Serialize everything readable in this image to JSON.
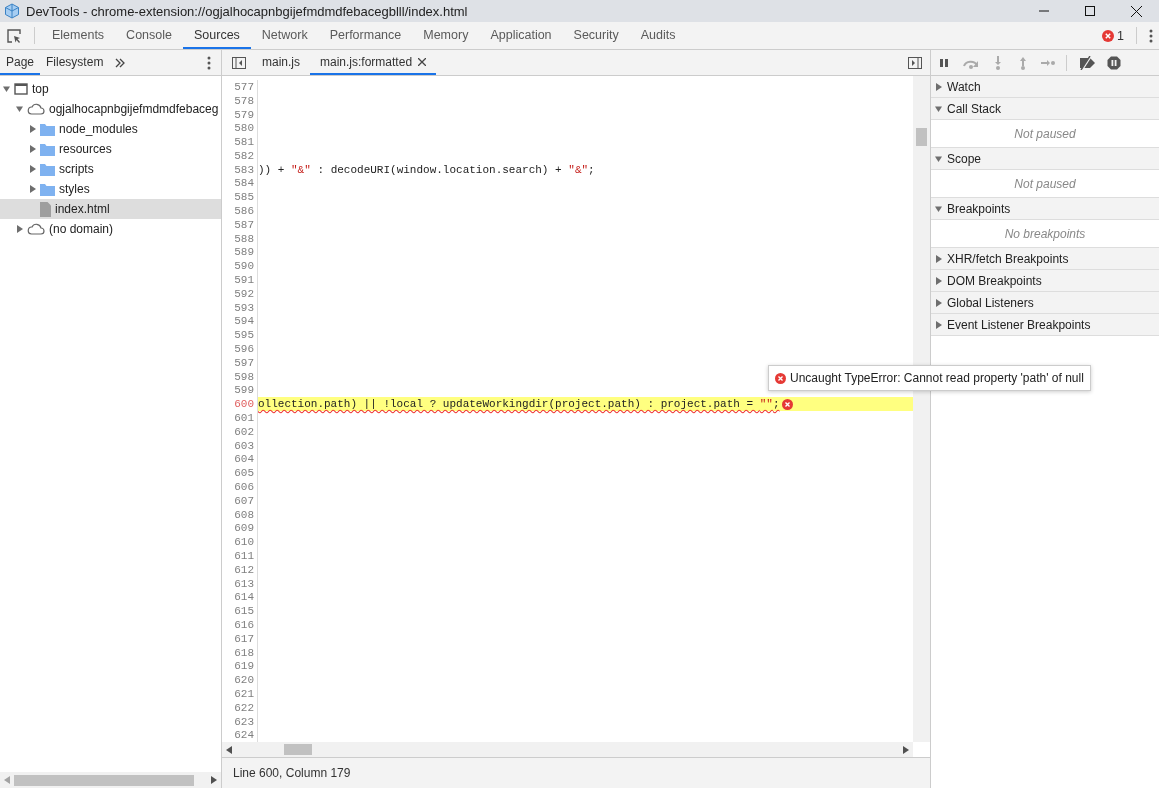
{
  "window": {
    "title": "DevTools - chrome-extension://ogjalhocapnbgijefmdmdfebacegblll/index.html"
  },
  "main_tabs": [
    {
      "label": "Elements",
      "selected": false
    },
    {
      "label": "Console",
      "selected": false
    },
    {
      "label": "Sources",
      "selected": true
    },
    {
      "label": "Network",
      "selected": false
    },
    {
      "label": "Performance",
      "selected": false
    },
    {
      "label": "Memory",
      "selected": false
    },
    {
      "label": "Application",
      "selected": false
    },
    {
      "label": "Security",
      "selected": false
    },
    {
      "label": "Audits",
      "selected": false
    }
  ],
  "error_count": "1",
  "navigator": {
    "tabs": [
      {
        "label": "Page",
        "selected": true
      },
      {
        "label": "Filesystem",
        "selected": false
      }
    ],
    "tree": [
      {
        "label": "top",
        "kind": "frame",
        "expanded": true,
        "selected": false,
        "children": [
          {
            "label": "ogjalhocapnbgijefmdmdfebaceg",
            "kind": "domain",
            "expanded": true,
            "selected": false,
            "children": [
              {
                "label": "node_modules",
                "kind": "folder",
                "expanded": false,
                "selected": false
              },
              {
                "label": "resources",
                "kind": "folder",
                "expanded": false,
                "selected": false
              },
              {
                "label": "scripts",
                "kind": "folder",
                "expanded": false,
                "selected": false
              },
              {
                "label": "styles",
                "kind": "folder",
                "expanded": false,
                "selected": false
              },
              {
                "label": "index.html",
                "kind": "file",
                "selected": true
              }
            ]
          },
          {
            "label": "(no domain)",
            "kind": "domain",
            "expanded": false,
            "selected": false
          }
        ]
      }
    ]
  },
  "editor": {
    "tabs": [
      {
        "label": "main.js",
        "selected": false
      },
      {
        "label": "main.js:formatted",
        "selected": true
      }
    ],
    "lines": [
      {
        "number": "577",
        "error": false
      },
      {
        "number": "578",
        "error": false
      },
      {
        "number": "579",
        "error": false
      },
      {
        "number": "580",
        "error": false
      },
      {
        "number": "581",
        "error": false
      },
      {
        "number": "582",
        "error": false
      },
      {
        "number": "583",
        "error": false,
        "tokens": [
          {
            "text": ")) + ",
            "kind": "plain"
          },
          {
            "text": "\"&\"",
            "kind": "string"
          },
          {
            "text": " : decodeURI(window.location.search) + ",
            "kind": "plain"
          },
          {
            "text": "\"&\"",
            "kind": "string"
          },
          {
            "text": ";",
            "kind": "plain"
          }
        ]
      },
      {
        "number": "584",
        "error": false
      },
      {
        "number": "585",
        "error": false
      },
      {
        "number": "586",
        "error": false
      },
      {
        "number": "587",
        "error": false
      },
      {
        "number": "588",
        "error": false
      },
      {
        "number": "589",
        "error": false
      },
      {
        "number": "590",
        "error": false
      },
      {
        "number": "591",
        "error": false
      },
      {
        "number": "592",
        "error": false
      },
      {
        "number": "593",
        "error": false
      },
      {
        "number": "594",
        "error": false
      },
      {
        "number": "595",
        "error": false
      },
      {
        "number": "596",
        "error": false
      },
      {
        "number": "597",
        "error": false
      },
      {
        "number": "598",
        "error": false
      },
      {
        "number": "599",
        "error": false
      },
      {
        "number": "600",
        "error": true,
        "message": "Uncaught TypeError: Cannot read property 'path' of null",
        "tokens": [
          {
            "text": "ollection.path) || !local ? updateWorkingdir(project.path) : project.path = ",
            "kind": "plain"
          },
          {
            "text": "\"\"",
            "kind": "string"
          },
          {
            "text": ";",
            "kind": "plain"
          }
        ]
      },
      {
        "number": "601",
        "error": false
      },
      {
        "number": "602",
        "error": false
      },
      {
        "number": "603",
        "error": false
      },
      {
        "number": "604",
        "error": false
      },
      {
        "number": "605",
        "error": false
      },
      {
        "number": "606",
        "error": false
      },
      {
        "number": "607",
        "error": false
      },
      {
        "number": "608",
        "error": false
      },
      {
        "number": "609",
        "error": false
      },
      {
        "number": "610",
        "error": false
      },
      {
        "number": "611",
        "error": false
      },
      {
        "number": "612",
        "error": false
      },
      {
        "number": "613",
        "error": false
      },
      {
        "number": "614",
        "error": false
      },
      {
        "number": "615",
        "error": false
      },
      {
        "number": "616",
        "error": false
      },
      {
        "number": "617",
        "error": false
      },
      {
        "number": "618",
        "error": false
      },
      {
        "number": "619",
        "error": false
      },
      {
        "number": "620",
        "error": false
      },
      {
        "number": "621",
        "error": false
      },
      {
        "number": "622",
        "error": false
      },
      {
        "number": "623",
        "error": false
      },
      {
        "number": "624",
        "error": false
      }
    ],
    "status": "Line 600, Column 179"
  },
  "debugger": {
    "sections": [
      {
        "title": "Watch",
        "expanded": false
      },
      {
        "title": "Call Stack",
        "expanded": true,
        "body": "Not paused"
      },
      {
        "title": "Scope",
        "expanded": true,
        "body": "Not paused"
      },
      {
        "title": "Breakpoints",
        "expanded": true,
        "body": "No breakpoints"
      },
      {
        "title": "XHR/fetch Breakpoints",
        "expanded": false
      },
      {
        "title": "DOM Breakpoints",
        "expanded": false
      },
      {
        "title": "Global Listeners",
        "expanded": false
      },
      {
        "title": "Event Listener Breakpoints",
        "expanded": false
      }
    ]
  }
}
